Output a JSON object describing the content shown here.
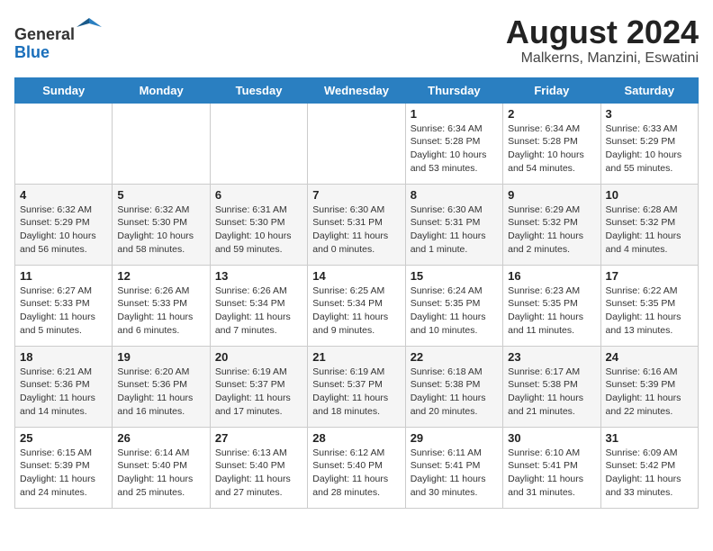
{
  "header": {
    "logo_line1": "General",
    "logo_line2": "Blue",
    "title": "August 2024",
    "subtitle": "Malkerns, Manzini, Eswatini"
  },
  "weekdays": [
    "Sunday",
    "Monday",
    "Tuesday",
    "Wednesday",
    "Thursday",
    "Friday",
    "Saturday"
  ],
  "weeks": [
    [
      {
        "day": "",
        "info": ""
      },
      {
        "day": "",
        "info": ""
      },
      {
        "day": "",
        "info": ""
      },
      {
        "day": "",
        "info": ""
      },
      {
        "day": "1",
        "info": "Sunrise: 6:34 AM\nSunset: 5:28 PM\nDaylight: 10 hours\nand 53 minutes."
      },
      {
        "day": "2",
        "info": "Sunrise: 6:34 AM\nSunset: 5:28 PM\nDaylight: 10 hours\nand 54 minutes."
      },
      {
        "day": "3",
        "info": "Sunrise: 6:33 AM\nSunset: 5:29 PM\nDaylight: 10 hours\nand 55 minutes."
      }
    ],
    [
      {
        "day": "4",
        "info": "Sunrise: 6:32 AM\nSunset: 5:29 PM\nDaylight: 10 hours\nand 56 minutes."
      },
      {
        "day": "5",
        "info": "Sunrise: 6:32 AM\nSunset: 5:30 PM\nDaylight: 10 hours\nand 58 minutes."
      },
      {
        "day": "6",
        "info": "Sunrise: 6:31 AM\nSunset: 5:30 PM\nDaylight: 10 hours\nand 59 minutes."
      },
      {
        "day": "7",
        "info": "Sunrise: 6:30 AM\nSunset: 5:31 PM\nDaylight: 11 hours\nand 0 minutes."
      },
      {
        "day": "8",
        "info": "Sunrise: 6:30 AM\nSunset: 5:31 PM\nDaylight: 11 hours\nand 1 minute."
      },
      {
        "day": "9",
        "info": "Sunrise: 6:29 AM\nSunset: 5:32 PM\nDaylight: 11 hours\nand 2 minutes."
      },
      {
        "day": "10",
        "info": "Sunrise: 6:28 AM\nSunset: 5:32 PM\nDaylight: 11 hours\nand 4 minutes."
      }
    ],
    [
      {
        "day": "11",
        "info": "Sunrise: 6:27 AM\nSunset: 5:33 PM\nDaylight: 11 hours\nand 5 minutes."
      },
      {
        "day": "12",
        "info": "Sunrise: 6:26 AM\nSunset: 5:33 PM\nDaylight: 11 hours\nand 6 minutes."
      },
      {
        "day": "13",
        "info": "Sunrise: 6:26 AM\nSunset: 5:34 PM\nDaylight: 11 hours\nand 7 minutes."
      },
      {
        "day": "14",
        "info": "Sunrise: 6:25 AM\nSunset: 5:34 PM\nDaylight: 11 hours\nand 9 minutes."
      },
      {
        "day": "15",
        "info": "Sunrise: 6:24 AM\nSunset: 5:35 PM\nDaylight: 11 hours\nand 10 minutes."
      },
      {
        "day": "16",
        "info": "Sunrise: 6:23 AM\nSunset: 5:35 PM\nDaylight: 11 hours\nand 11 minutes."
      },
      {
        "day": "17",
        "info": "Sunrise: 6:22 AM\nSunset: 5:35 PM\nDaylight: 11 hours\nand 13 minutes."
      }
    ],
    [
      {
        "day": "18",
        "info": "Sunrise: 6:21 AM\nSunset: 5:36 PM\nDaylight: 11 hours\nand 14 minutes."
      },
      {
        "day": "19",
        "info": "Sunrise: 6:20 AM\nSunset: 5:36 PM\nDaylight: 11 hours\nand 16 minutes."
      },
      {
        "day": "20",
        "info": "Sunrise: 6:19 AM\nSunset: 5:37 PM\nDaylight: 11 hours\nand 17 minutes."
      },
      {
        "day": "21",
        "info": "Sunrise: 6:19 AM\nSunset: 5:37 PM\nDaylight: 11 hours\nand 18 minutes."
      },
      {
        "day": "22",
        "info": "Sunrise: 6:18 AM\nSunset: 5:38 PM\nDaylight: 11 hours\nand 20 minutes."
      },
      {
        "day": "23",
        "info": "Sunrise: 6:17 AM\nSunset: 5:38 PM\nDaylight: 11 hours\nand 21 minutes."
      },
      {
        "day": "24",
        "info": "Sunrise: 6:16 AM\nSunset: 5:39 PM\nDaylight: 11 hours\nand 22 minutes."
      }
    ],
    [
      {
        "day": "25",
        "info": "Sunrise: 6:15 AM\nSunset: 5:39 PM\nDaylight: 11 hours\nand 24 minutes."
      },
      {
        "day": "26",
        "info": "Sunrise: 6:14 AM\nSunset: 5:40 PM\nDaylight: 11 hours\nand 25 minutes."
      },
      {
        "day": "27",
        "info": "Sunrise: 6:13 AM\nSunset: 5:40 PM\nDaylight: 11 hours\nand 27 minutes."
      },
      {
        "day": "28",
        "info": "Sunrise: 6:12 AM\nSunset: 5:40 PM\nDaylight: 11 hours\nand 28 minutes."
      },
      {
        "day": "29",
        "info": "Sunrise: 6:11 AM\nSunset: 5:41 PM\nDaylight: 11 hours\nand 30 minutes."
      },
      {
        "day": "30",
        "info": "Sunrise: 6:10 AM\nSunset: 5:41 PM\nDaylight: 11 hours\nand 31 minutes."
      },
      {
        "day": "31",
        "info": "Sunrise: 6:09 AM\nSunset: 5:42 PM\nDaylight: 11 hours\nand 33 minutes."
      }
    ]
  ]
}
